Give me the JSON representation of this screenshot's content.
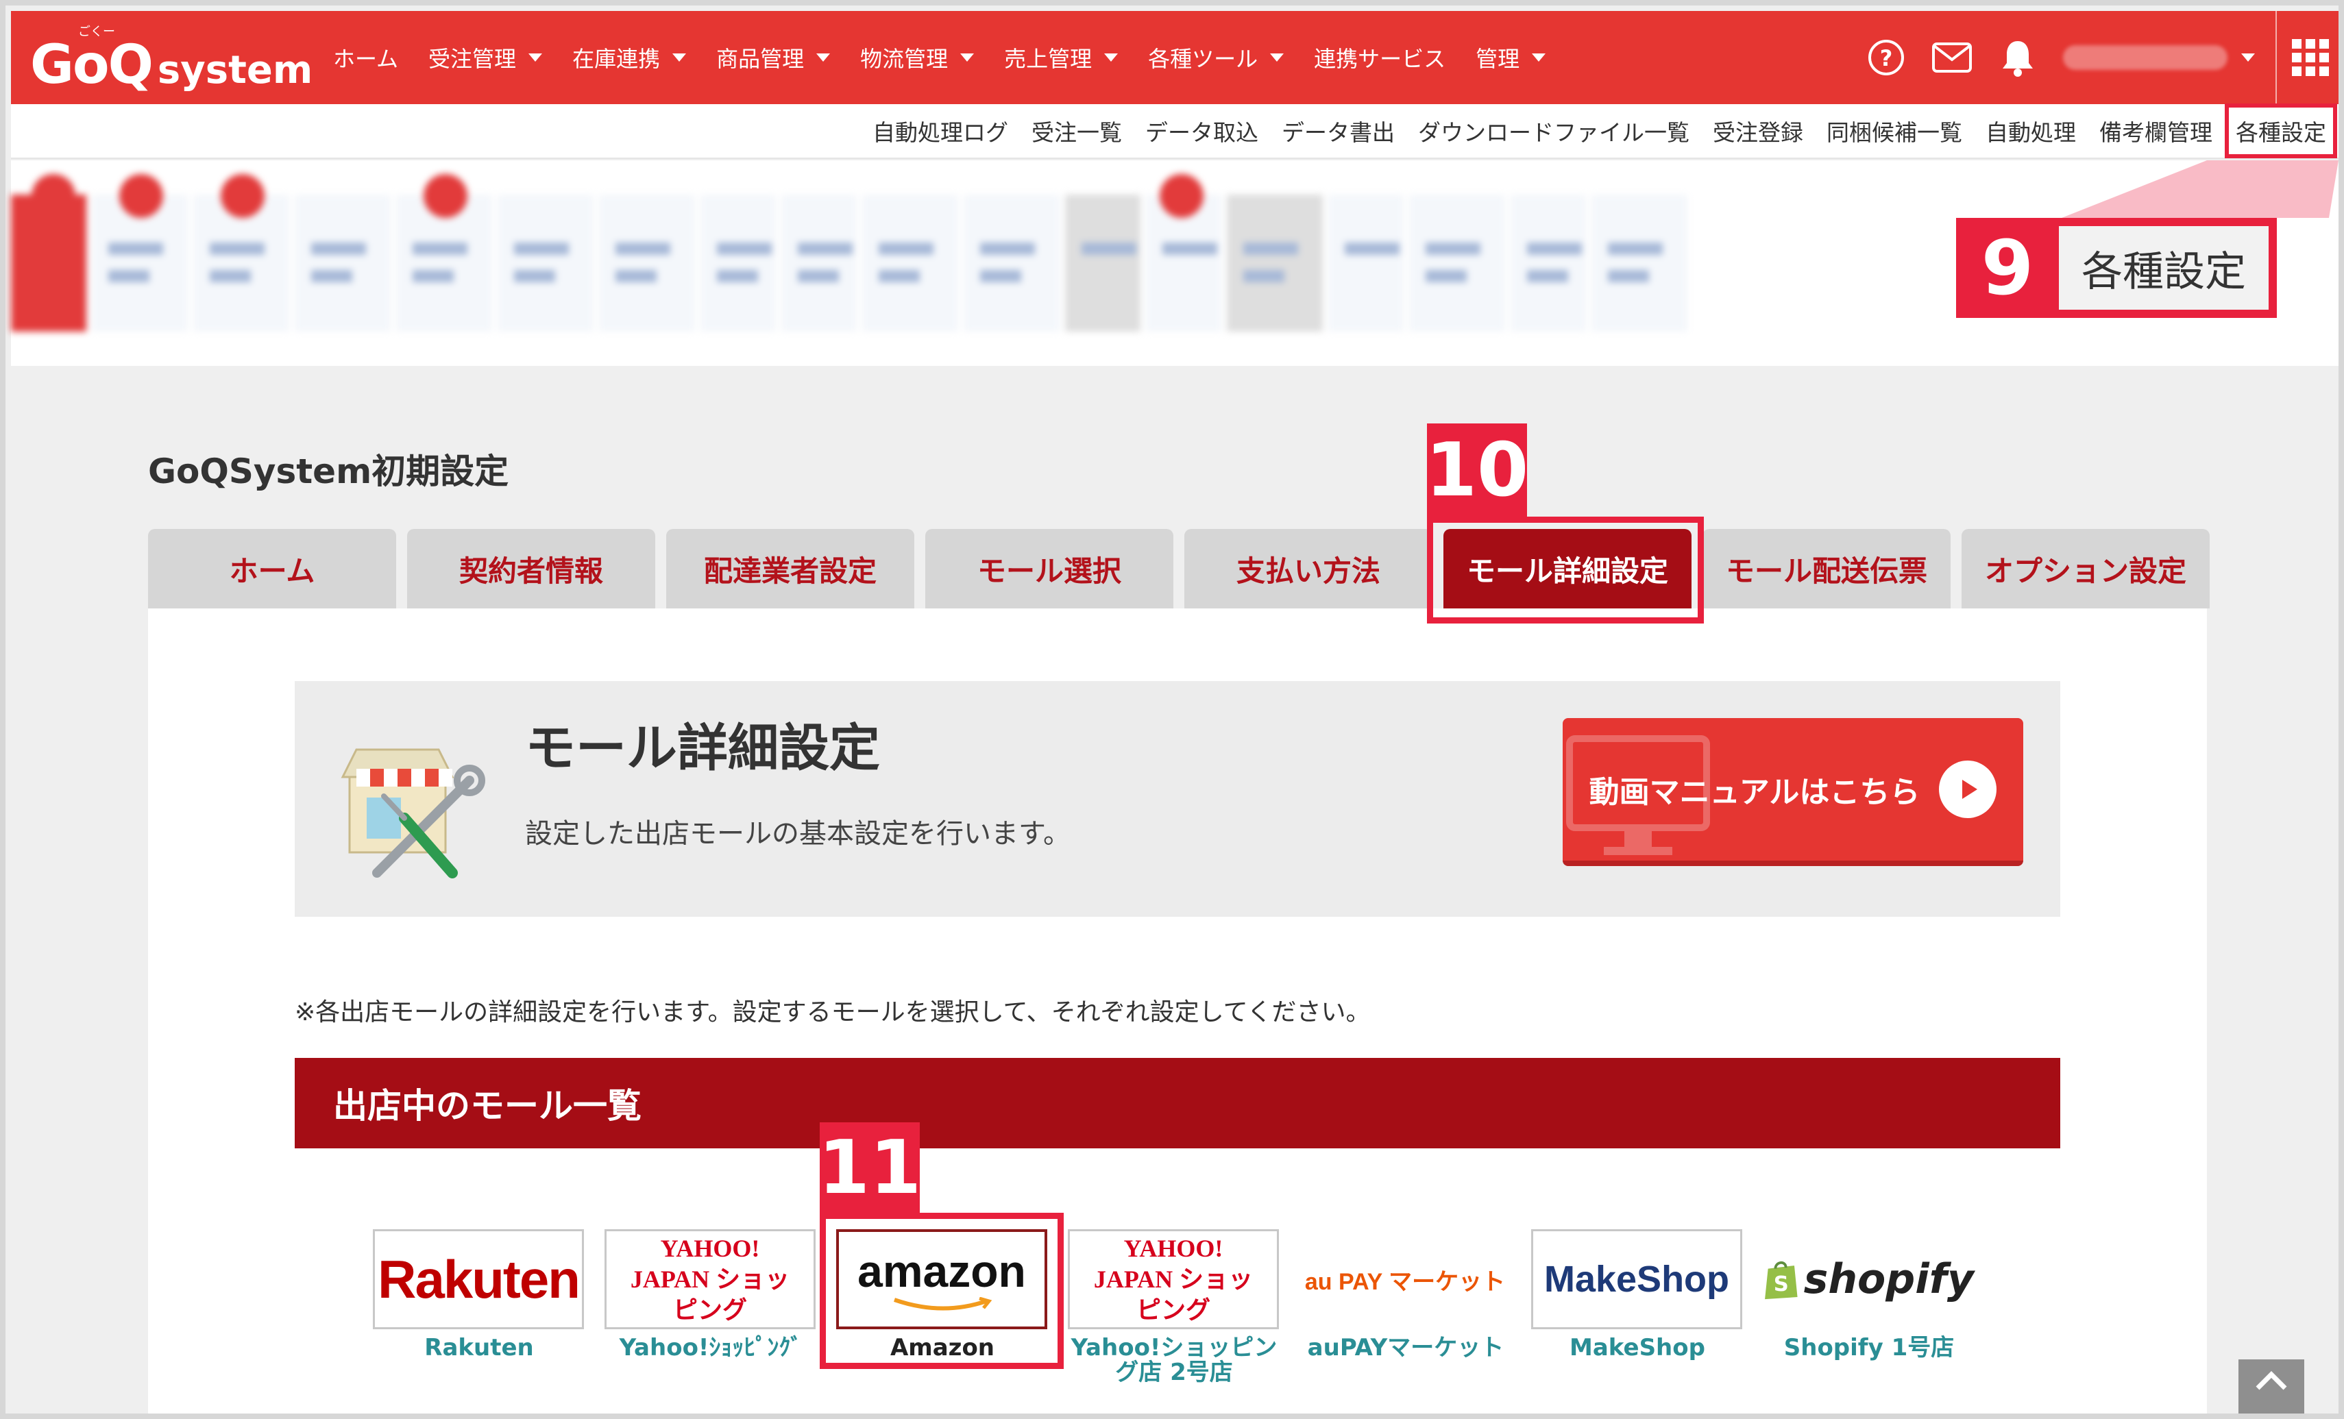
{
  "header": {
    "logo_main": "GoQ",
    "logo_sub": "system",
    "logo_ruby": "ごくー",
    "nav": [
      {
        "label": "ホーム",
        "dropdown": false
      },
      {
        "label": "受注管理",
        "dropdown": true
      },
      {
        "label": "在庫連携",
        "dropdown": true
      },
      {
        "label": "商品管理",
        "dropdown": true
      },
      {
        "label": "物流管理",
        "dropdown": true
      },
      {
        "label": "売上管理",
        "dropdown": true
      },
      {
        "label": "各種ツール",
        "dropdown": true
      },
      {
        "label": "連携サービス",
        "dropdown": false
      },
      {
        "label": "管理",
        "dropdown": true
      }
    ],
    "icons": [
      "help-icon",
      "mail-icon",
      "bell-icon",
      "apps-grid-icon"
    ]
  },
  "subnav": [
    "自動処理ログ",
    "受注一覧",
    "データ取込",
    "データ書出",
    "ダウンロードファイル一覧",
    "受注登録",
    "同梱候補一覧",
    "自動処理",
    "備考欄管理",
    "各種設定"
  ],
  "callouts": {
    "c9_num": "9",
    "c9_text": "各種設定",
    "c10_num": "10",
    "c11_num": "11"
  },
  "page": {
    "title": "GoQSystem初期設定",
    "tabs": [
      "ホーム",
      "契約者情報",
      "配達業者設定",
      "モール選択",
      "支払い方法",
      "モール詳細設定",
      "モール配送伝票",
      "オプション設定"
    ],
    "active_tab": 5
  },
  "hero": {
    "title": "モール詳細設定",
    "desc": "設定した出店モールの基本設定を行います。",
    "video_button": "動画マニュアルはこちら"
  },
  "note": "※各出店モールの詳細設定を行います。設定するモールを選択して、それぞれ設定してください。",
  "mall_list": {
    "header": "出店中のモール一覧",
    "malls": [
      {
        "logo": "Rakuten",
        "name": "Rakuten"
      },
      {
        "logo": "YAHOO! JAPAN ショッピング",
        "name": "Yahoo!ｼｮｯﾋﾟﾝｸﾞ"
      },
      {
        "logo": "amazon",
        "name": "Amazon"
      },
      {
        "logo": "YAHOO! JAPAN ショッピング",
        "name": "Yahoo!ショッピング店 2号店"
      },
      {
        "logo": "au PAY マーケット",
        "name": "auPAYマーケット"
      },
      {
        "logo": "MakeShop",
        "name": "MakeShop"
      },
      {
        "logo": "shopify",
        "name": "Shopify 1号店"
      }
    ]
  },
  "scroll_top_label": "TOP",
  "colors": {
    "header_red": "#e53632",
    "dark_red": "#a50d15",
    "callout_red": "#e8213d",
    "teal_link": "#2a8e95"
  }
}
